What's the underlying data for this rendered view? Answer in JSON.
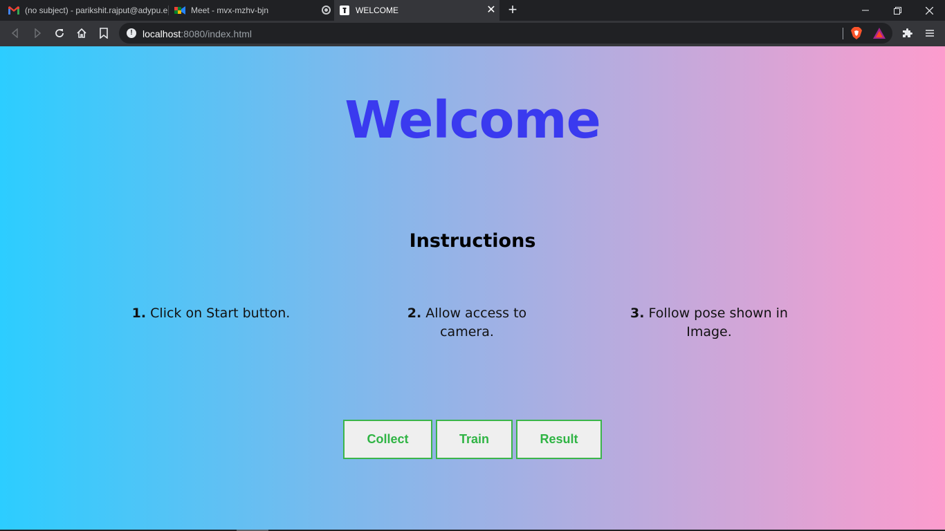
{
  "browser": {
    "tabs": [
      {
        "title": "(no subject) - parikshit.rajput@adypu.edu.in",
        "icon": "gmail-icon",
        "active": false
      },
      {
        "title": "Meet - mvx-mzhv-bjn",
        "icon": "google-meet-icon",
        "active": false
      },
      {
        "title": "WELCOME",
        "icon": "page-icon",
        "active": true
      }
    ],
    "address": {
      "host": "localhost",
      "rest": ":8080/index.html"
    }
  },
  "page": {
    "heading": "Welcome",
    "instructions_title": "Instructions",
    "steps": [
      {
        "num": "1.",
        "text": " Click on Start button."
      },
      {
        "num": "2.",
        "text": " Allow access to camera."
      },
      {
        "num": "3.",
        "text": " Follow pose shown in Image."
      }
    ],
    "buttons": {
      "collect": "Collect",
      "train": "Train",
      "result": "Result"
    },
    "colors": {
      "heading": "#3a3aef",
      "button_text": "#2fb444",
      "gradient_left": "#2ccdff",
      "gradient_right": "#fc9ccd"
    }
  }
}
